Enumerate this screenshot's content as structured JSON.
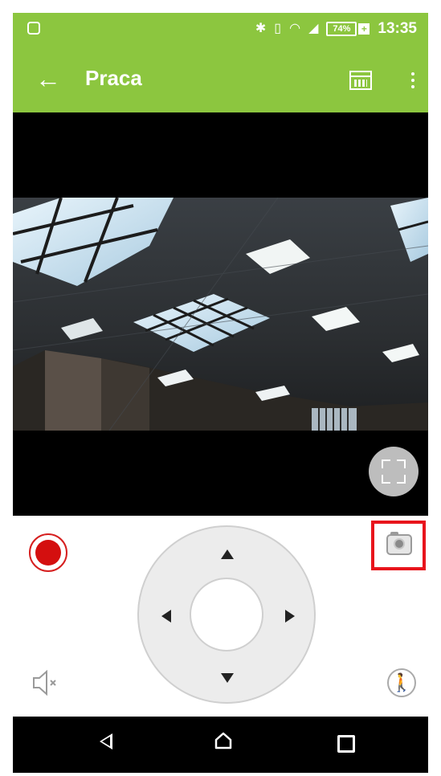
{
  "status_bar": {
    "battery_percent": "74%",
    "time": "13:35",
    "icons": [
      "bluetooth-icon",
      "vibrate-icon",
      "wifi-icon",
      "signal-icon",
      "battery-icon"
    ]
  },
  "toolbar": {
    "title": "Praca",
    "back_icon": "arrow-left-icon",
    "calendar_icon": "calendar-icon",
    "menu_icon": "overflow-menu-icon"
  },
  "controls": {
    "record_icon": "record-icon",
    "snapshot_icon": "camera-icon",
    "speaker_icon": "speaker-muted-icon",
    "motion_icon": "person-walking-icon",
    "ptz": [
      "up",
      "down",
      "left",
      "right"
    ]
  },
  "colors": {
    "brand": "#8cc63f",
    "record": "#d40f0f",
    "highlight": "#e8141c"
  }
}
